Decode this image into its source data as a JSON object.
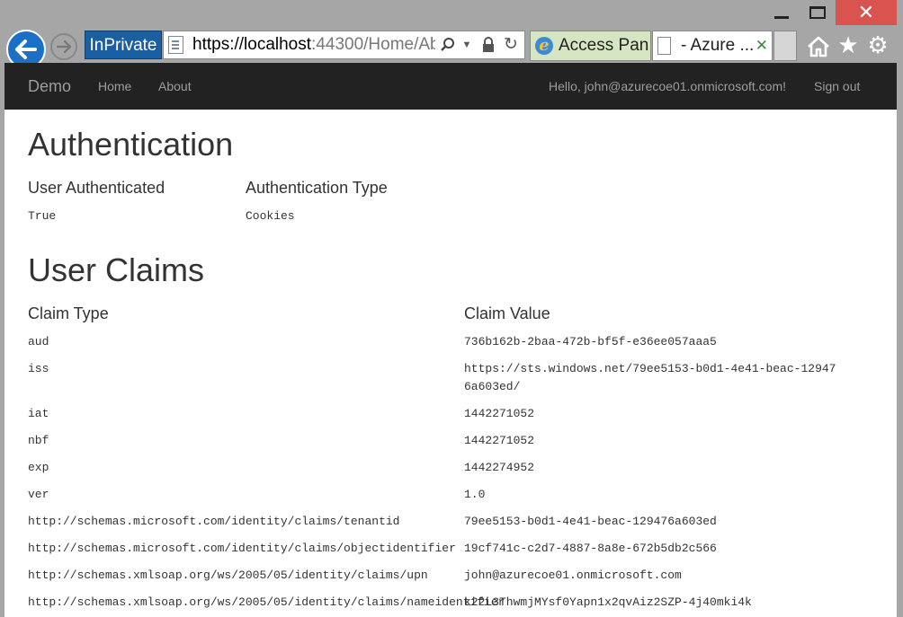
{
  "browser": {
    "inprivate_label": "InPrivate",
    "url_main": "https://localhost",
    "url_rest": ":44300/Home/Ab",
    "tabs": [
      {
        "label": "Access Pan..."
      },
      {
        "label": "- Azure ..."
      }
    ],
    "icons": [
      "back-arrow-icon",
      "forward-arrow-icon",
      "search-icon",
      "dropdown-icon",
      "lock-icon",
      "refresh-icon",
      "home-icon",
      "star-icon",
      "gear-icon"
    ]
  },
  "site": {
    "brand": "Demo",
    "nav": {
      "home": "Home",
      "about": "About",
      "hello": "Hello, john@azurecoe01.onmicrosoft.com!",
      "signout": "Sign out"
    }
  },
  "auth": {
    "title": "Authentication",
    "col1_header": "User Authenticated",
    "col2_header": "Authentication Type",
    "col1_value": "True",
    "col2_value": "Cookies"
  },
  "claims": {
    "title": "User Claims",
    "col1_header": "Claim Type",
    "col2_header": "Claim Value",
    "rows": [
      {
        "type": "aud",
        "value": "736b162b-2baa-472b-bf5f-e36ee057aaa5"
      },
      {
        "type": "iss",
        "value": "https://sts.windows.net/79ee5153-b0d1-4e41-beac-129476a603ed/"
      },
      {
        "type": "iat",
        "value": "1442271052"
      },
      {
        "type": "nbf",
        "value": "1442271052"
      },
      {
        "type": "exp",
        "value": "1442274952"
      },
      {
        "type": "ver",
        "value": "1.0"
      },
      {
        "type": "http://schemas.microsoft.com/identity/claims/tenantid",
        "value": "79ee5153-b0d1-4e41-beac-129476a603ed"
      },
      {
        "type": "http://schemas.microsoft.com/identity/claims/objectidentifier",
        "value": "19cf741c-c2d7-4887-8a8e-672b5db2c566"
      },
      {
        "type": "http://schemas.xmlsoap.org/ws/2005/05/identity/claims/upn",
        "value": "john@azurecoe01.onmicrosoft.com"
      },
      {
        "type": "http://schemas.xmlsoap.org/ws/2005/05/identity/claims/nameidentifier",
        "value": "k22L3ThwmjMYsf0Yapn1x2qvAiz2SZP-4j40mki4k"
      }
    ]
  },
  "colors": {
    "navbar": "#222222",
    "inprivate": "#1b5fa3",
    "close_button": "#d9534f",
    "chrome": "#a6a6a6"
  }
}
